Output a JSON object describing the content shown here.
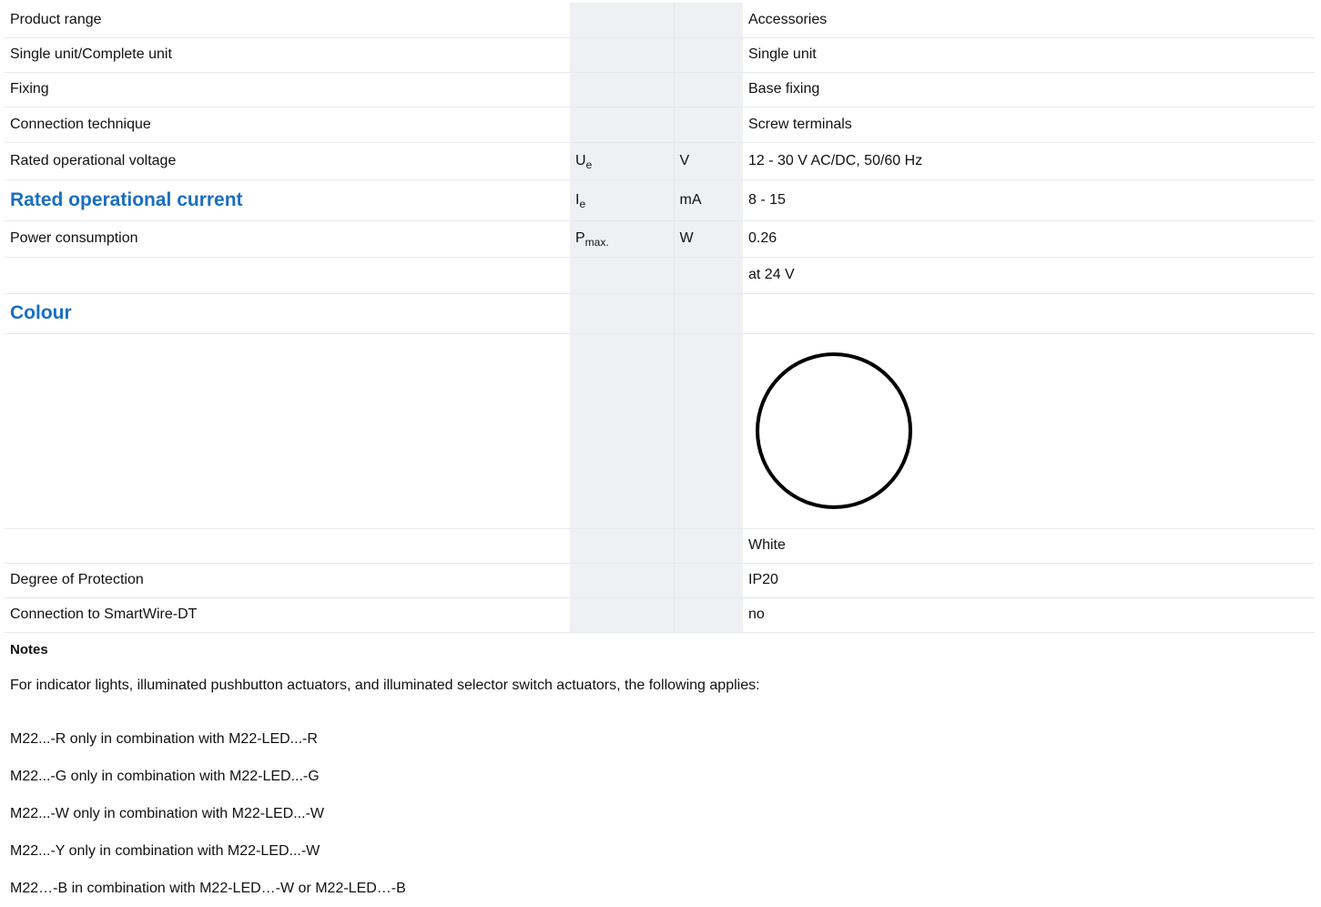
{
  "rows": [
    {
      "label": "Product range",
      "symbol": "",
      "sub": "",
      "unit": "",
      "value": "Accessories"
    },
    {
      "label": "Single unit/Complete unit",
      "symbol": "",
      "sub": "",
      "unit": "",
      "value": "Single unit"
    },
    {
      "label": "Fixing",
      "symbol": "",
      "sub": "",
      "unit": "",
      "value": "Base fixing"
    },
    {
      "label": "Connection technique",
      "symbol": "",
      "sub": "",
      "unit": "",
      "value": "Screw terminals"
    },
    {
      "label": "Rated operational voltage",
      "symbol": "U",
      "sub": "e",
      "unit": "V",
      "value": "12 - 30 V AC/DC, 50/60 Hz"
    },
    {
      "label": "Rated operational current",
      "symbol": "I",
      "sub": "e",
      "unit": "mA",
      "value": "8 - 15"
    },
    {
      "label": "Power consumption",
      "symbol": "P",
      "sub": "max.",
      "unit": "W",
      "value": "0.26"
    },
    {
      "label": "",
      "symbol": "",
      "sub": "",
      "unit": "",
      "value": "at 24 V"
    },
    {
      "label": "Colour",
      "symbol": "",
      "sub": "",
      "unit": "",
      "value": ""
    },
    {
      "label": "",
      "symbol": "",
      "sub": "",
      "unit": "",
      "value": "White"
    },
    {
      "label": "Degree of Protection",
      "symbol": "",
      "sub": "",
      "unit": "",
      "value": "IP20"
    },
    {
      "label": "Connection to SmartWire-DT",
      "symbol": "",
      "sub": "",
      "unit": "",
      "value": "no"
    }
  ],
  "colour_swatch": {
    "icon": "white-circle-icon",
    "fill": "#ffffff",
    "stroke": "#000000"
  },
  "notes": {
    "heading": "Notes",
    "intro": "For indicator lights, illuminated pushbutton actuators, and illuminated selector switch actuators, the following applies:",
    "items": [
      "M22...-R only in combination with M22-LED...-R",
      "M22...-G only in combination with M22-LED...-G",
      "M22...-W only in combination with M22-LED...-W",
      "M22...-Y only in combination with M22-LED...-W",
      "M22…-B in combination with M22-LED…-W or M22-LED…-B"
    ]
  }
}
